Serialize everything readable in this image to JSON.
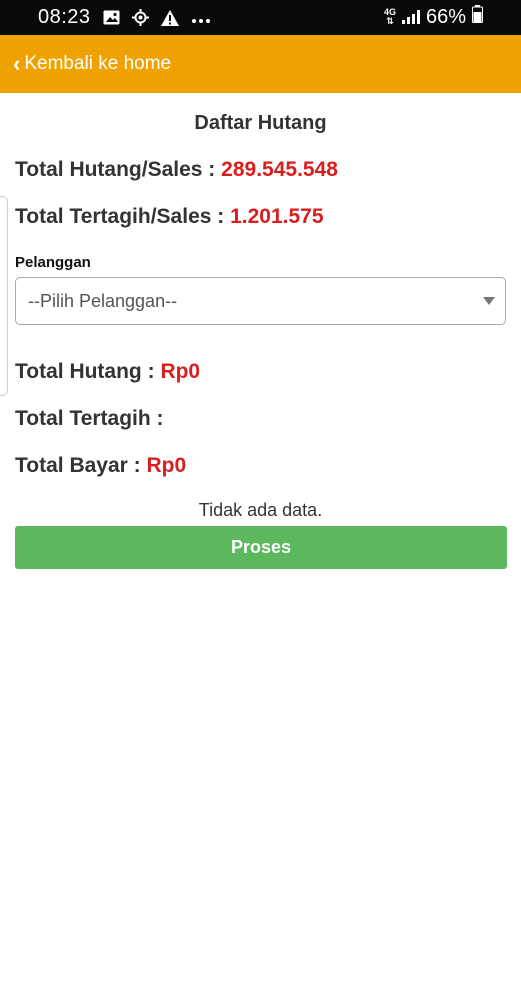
{
  "status_bar": {
    "time": "08:23",
    "network": "4G",
    "battery_percent": "66%",
    "icons": [
      "image-icon",
      "location-icon",
      "warning-icon",
      "more-icon",
      "network-4g-icon",
      "signal-icon",
      "battery-icon"
    ]
  },
  "header": {
    "back_label": "Kembali ke home",
    "background_color": "#f0a202"
  },
  "page": {
    "title": "Daftar Hutang",
    "total_hutang_sales_label": "Total Hutang/Sales :",
    "total_hutang_sales_value": "289.545.548",
    "total_tertagih_sales_label": "Total Tertagih/Sales :",
    "total_tertagih_sales_value": "1.201.575",
    "pelanggan_label": "Pelanggan",
    "pelanggan_selected": "--Pilih Pelanggan--",
    "total_hutang_label": "Total Hutang :",
    "total_hutang_value": "Rp0",
    "total_tertagih_label": "Total Tertagih :",
    "total_tertagih_value": "",
    "total_bayar_label": "Total Bayar :",
    "total_bayar_value": "Rp0",
    "empty_message": "Tidak ada data.",
    "proses_button": "Proses"
  },
  "colors": {
    "accent_red": "#d81e1e",
    "button_green": "#5cb85c"
  }
}
